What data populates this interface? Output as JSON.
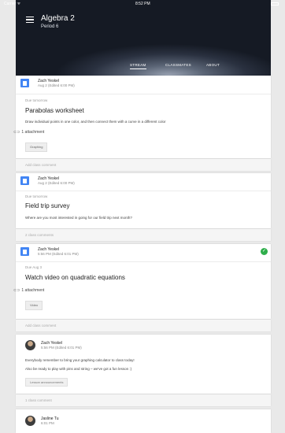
{
  "status_bar": {
    "carrier": "Carrier ᯤ",
    "time": "8:52 PM"
  },
  "header": {
    "class_title": "Algebra 2",
    "class_subtitle": "Period 6",
    "tabs": [
      {
        "label": "STREAM",
        "active": true
      },
      {
        "label": "CLASSMATES",
        "active": false
      },
      {
        "label": "ABOUT",
        "active": false
      }
    ]
  },
  "stream": [
    {
      "author": "Zach Yeskel",
      "posted": "Aug 2 (Edited 6:00 PM)",
      "due": "Due tomorrow",
      "title": "Parabolas worksheet",
      "description": "Draw individual points in one color, and then connect them with a curve in a different color",
      "attachment_count": "1 attachment",
      "attachment_chip": "Graphing",
      "comment_bar": "Add class comment"
    },
    {
      "author": "Zach Yeskel",
      "posted": "Aug 2 (Edited 6:00 PM)",
      "due": "Due tomorrow",
      "title": "Field trip survey",
      "description": "Where are you most interested in going for our field trip next month?",
      "comment_bar": "2 class comments"
    },
    {
      "author": "Zach Yeskel",
      "posted": "5:56 PM (Edited 6:01 PM)",
      "due": "Due Aug 3",
      "title": "Watch video on quadratic equations",
      "attachment_count": "1 attachment",
      "attachment_chip": "Video",
      "comment_bar": "Add class comment",
      "done": true
    }
  ],
  "announcement": {
    "author": "Zach Yeskel",
    "posted": "5:56 PM (Edited 6:01 PM)",
    "line1": "Everybody remember to bring your graphing calculator to class today!",
    "line2": "Also be ready to play with pins and string – we've got a fun lesson :)",
    "chip": "Lesson announcements",
    "comment_bar": "1 class comment"
  },
  "last_post": {
    "author": "Jasline Tu",
    "posted": "6:01 PM"
  },
  "icons": {
    "assignment": "assignment-icon",
    "check": "check-circle-icon",
    "menu": "hamburger-menu-icon",
    "attachment": "paperclip-icon"
  },
  "colors": {
    "accent": "#4285f4",
    "done": "#2fae4b"
  }
}
